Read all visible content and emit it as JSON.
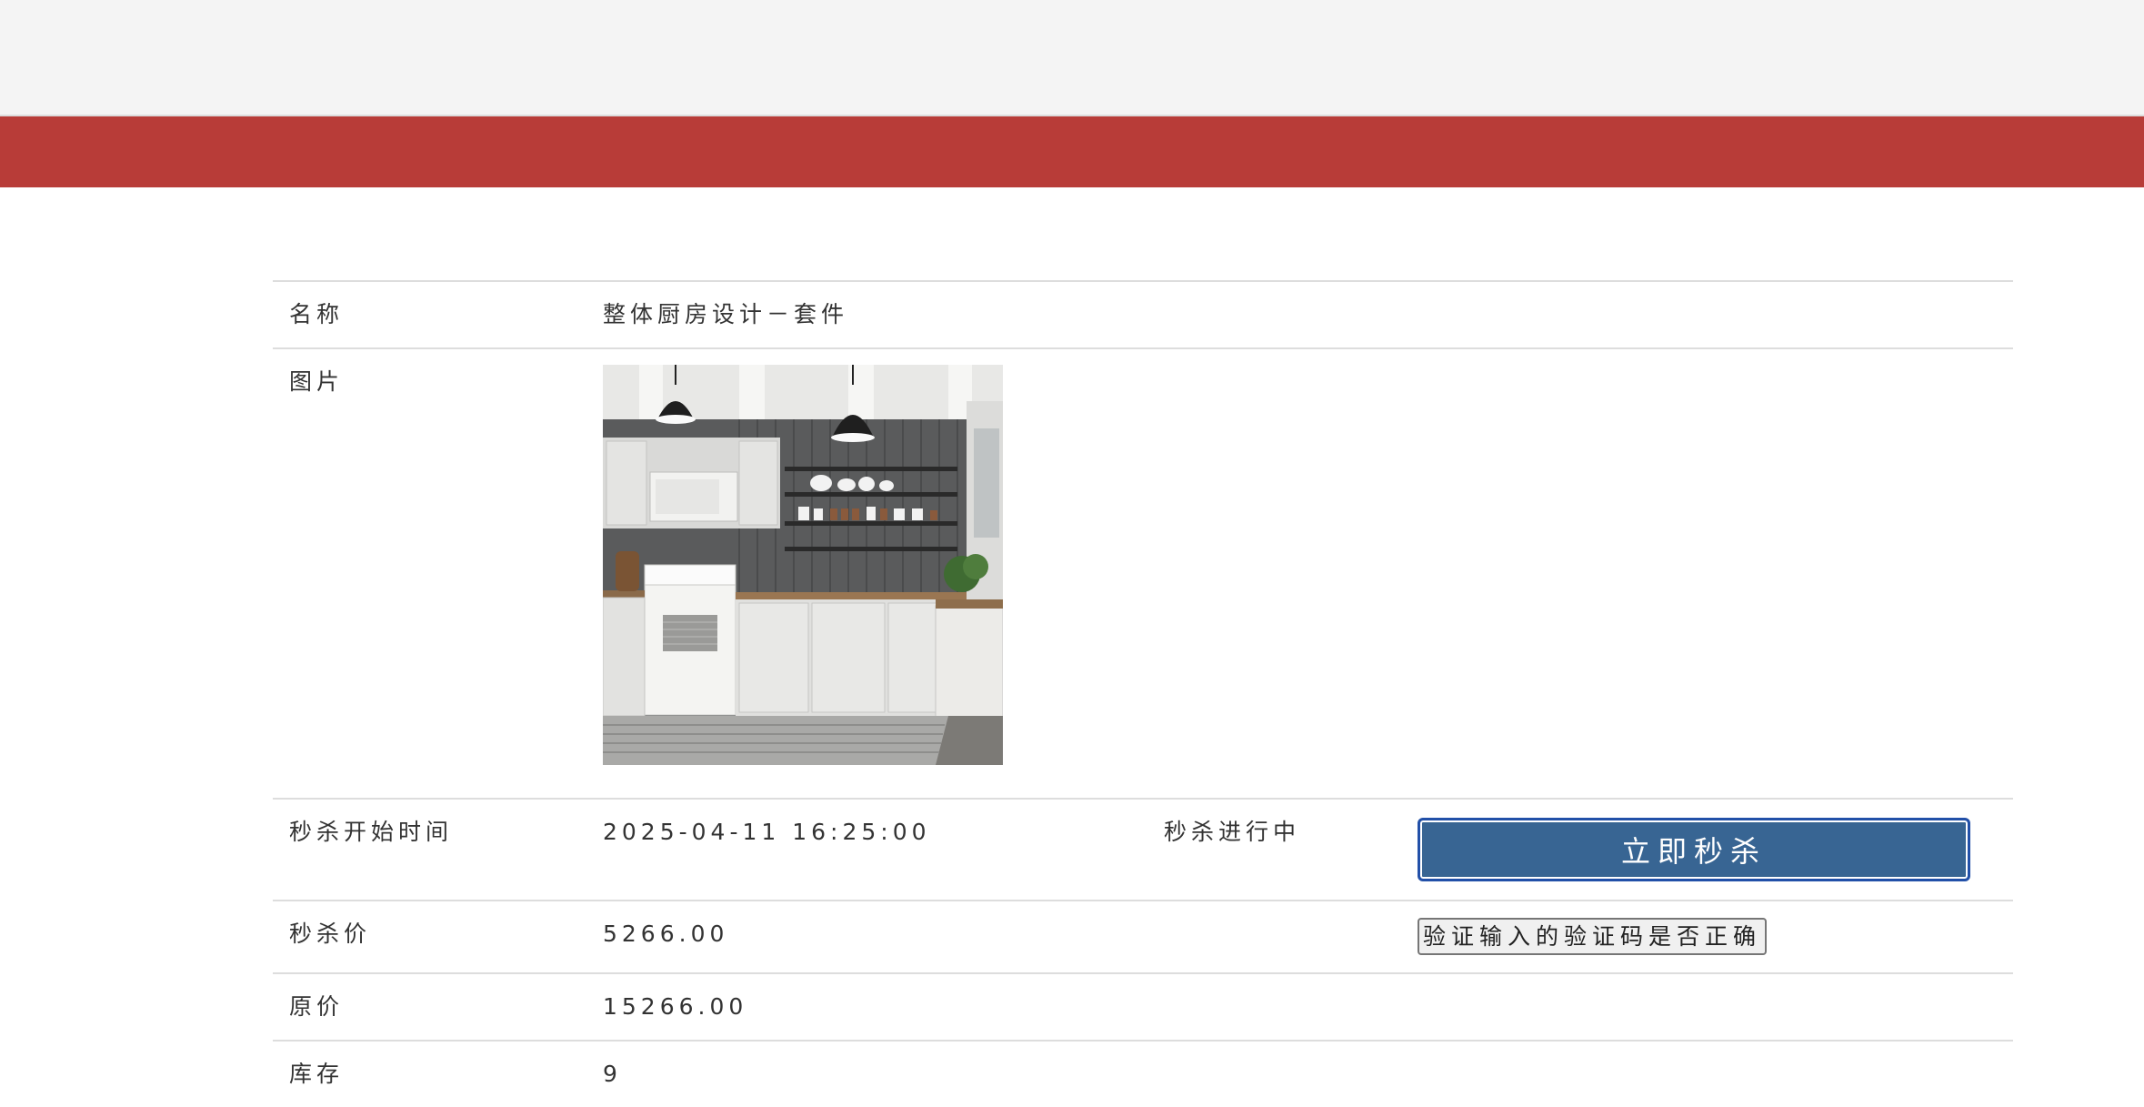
{
  "product": {
    "name_label": "名称",
    "name_value": "整体厨房设计－套件",
    "image_label": "图片",
    "image_icon": "kitchen-product-photo",
    "start_label": "秒杀开始时间",
    "start_value": "2025-04-11 16:25:00",
    "status_text": "秒杀进行中",
    "kill_button": "立即秒杀",
    "price_label": "秒杀价",
    "price_value": "5266.00",
    "verify_button": "验证输入的验证码是否正确",
    "orig_label": "原价",
    "orig_value": "15266.00",
    "stock_label": "库存",
    "stock_value": "9"
  },
  "colors": {
    "topbar": "#f4f4f4",
    "redbar": "#b83c38",
    "kill_button": "#386593"
  }
}
